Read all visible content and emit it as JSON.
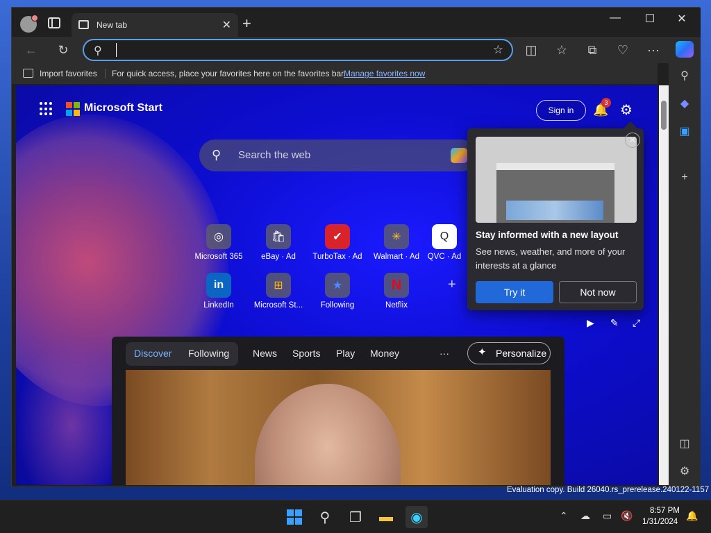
{
  "browser": {
    "tab_title": "New tab",
    "new_tab_icon": "+",
    "window_controls": [
      "—",
      "☐",
      "✕"
    ],
    "address": {
      "value": "",
      "placeholder": ""
    },
    "favorites_bar": {
      "import_label": "Import favorites",
      "hint": "For quick access, place your favorites here on the favorites bar.",
      "manage_link": "Manage favorites now"
    }
  },
  "page": {
    "brand": "Microsoft Start",
    "sign_in": "Sign in",
    "notification_count": "3",
    "search_placeholder": "Search the web",
    "quick_links": [
      {
        "label": "Microsoft 365",
        "icon": "m365-icon",
        "glyph": "◎"
      },
      {
        "label": "eBay · Ad",
        "icon": "ebay-icon",
        "glyph": "🛍"
      },
      {
        "label": "TurboTax · Ad",
        "icon": "turbotax-icon",
        "glyph": "✔"
      },
      {
        "label": "Walmart · Ad",
        "icon": "walmart-icon",
        "glyph": "✳"
      },
      {
        "label": "QVC · Ad",
        "icon": "qvc-icon",
        "glyph": "Q"
      },
      {
        "label": "LinkedIn",
        "icon": "linkedin-icon",
        "glyph": "in"
      },
      {
        "label": "Microsoft St...",
        "icon": "msstore-icon",
        "glyph": "⊞"
      },
      {
        "label": "Following",
        "icon": "following-icon",
        "glyph": "★"
      },
      {
        "label": "Netflix",
        "icon": "netflix-icon",
        "glyph": "N"
      }
    ],
    "popup": {
      "title": "Stay informed with a new layout",
      "description": "See news, weather, and more of your interests at a glance",
      "primary_button": "Try it",
      "secondary_button": "Not now"
    },
    "feed": {
      "tabs": [
        "Discover",
        "Following",
        "News",
        "Sports",
        "Play",
        "Money"
      ],
      "more": "···",
      "personalize": "Personalize"
    }
  },
  "os": {
    "watermark": "Evaluation copy. Build 26040.rs_prerelease.240122-1157",
    "time": "8:57 PM",
    "date": "1/31/2024"
  },
  "colors": {
    "accent": "#2169d9",
    "page_background": "#0d0dd0",
    "badge": "#d13438"
  }
}
